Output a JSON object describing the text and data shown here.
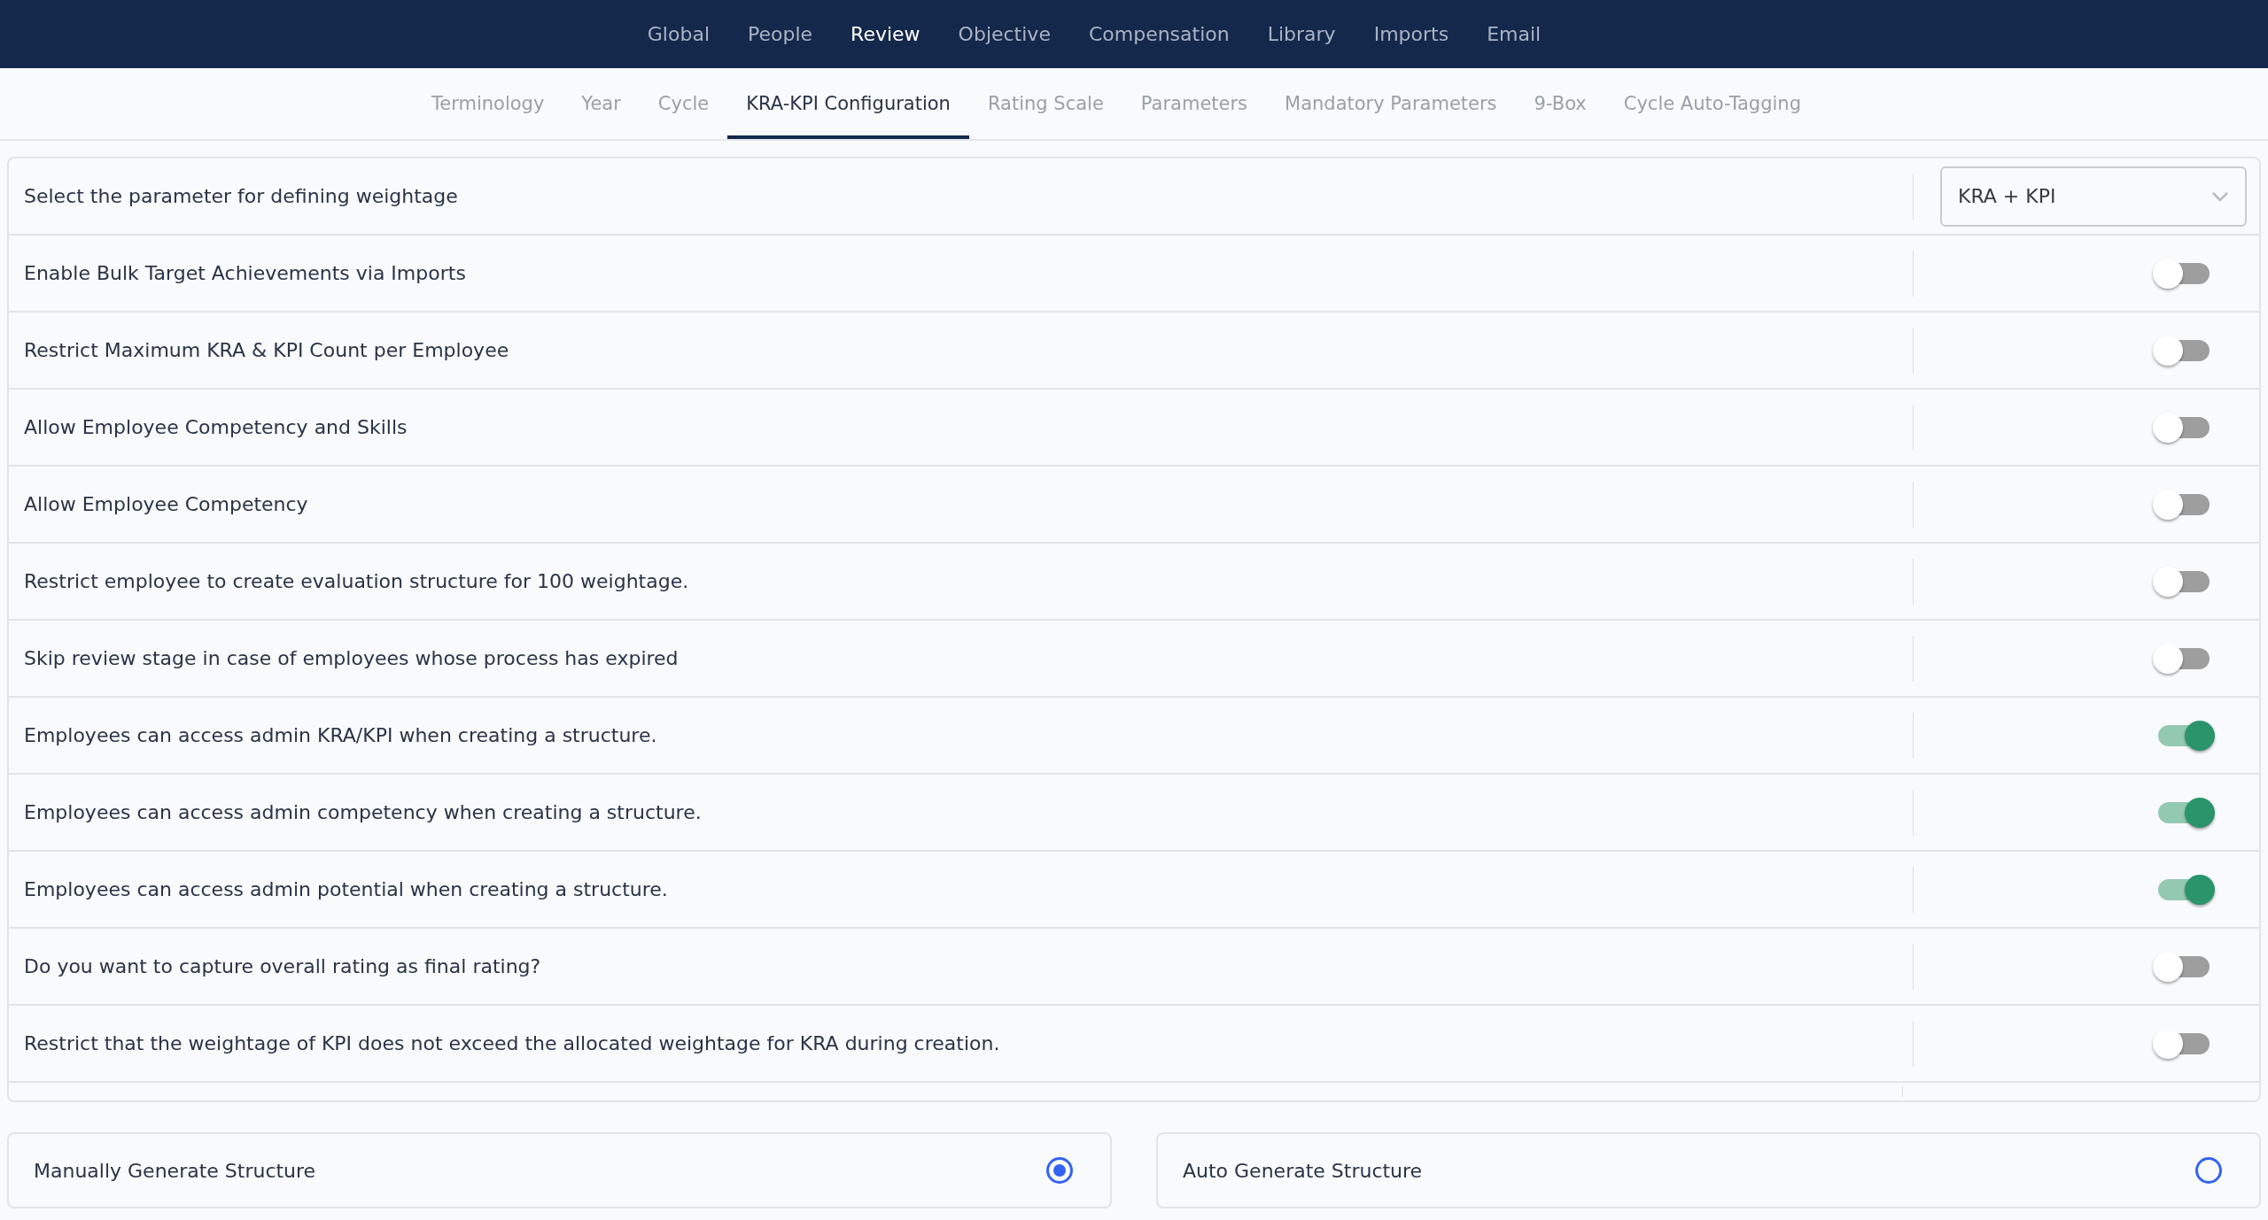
{
  "top_nav": [
    {
      "label": "Global",
      "selected": false
    },
    {
      "label": "People",
      "selected": false
    },
    {
      "label": "Review",
      "selected": true
    },
    {
      "label": "Objective",
      "selected": false
    },
    {
      "label": "Compensation",
      "selected": false
    },
    {
      "label": "Library",
      "selected": false
    },
    {
      "label": "Imports",
      "selected": false
    },
    {
      "label": "Email",
      "selected": false
    }
  ],
  "tabs": [
    {
      "label": "Terminology",
      "selected": false
    },
    {
      "label": "Year",
      "selected": false
    },
    {
      "label": "Cycle",
      "selected": false
    },
    {
      "label": "KRA-KPI Configuration",
      "selected": true
    },
    {
      "label": "Rating Scale",
      "selected": false
    },
    {
      "label": "Parameters",
      "selected": false
    },
    {
      "label": "Mandatory Parameters",
      "selected": false
    },
    {
      "label": "9-Box",
      "selected": false
    },
    {
      "label": "Cycle Auto-Tagging",
      "selected": false
    }
  ],
  "settings": [
    {
      "kind": "dropdown",
      "label": "Select the parameter for defining weightage",
      "value": "KRA + KPI"
    },
    {
      "kind": "toggle",
      "label": "Enable Bulk Target Achievements via Imports",
      "on": false
    },
    {
      "kind": "toggle",
      "label": "Restrict Maximum KRA & KPI Count per Employee",
      "on": false
    },
    {
      "kind": "toggle",
      "label": "Allow Employee Competency and Skills",
      "on": false
    },
    {
      "kind": "toggle",
      "label": "Allow Employee Competency",
      "on": false
    },
    {
      "kind": "toggle",
      "label": "Restrict employee to create evaluation structure for 100 weightage.",
      "on": false
    },
    {
      "kind": "toggle",
      "label": "Skip review stage in case of employees whose process has expired",
      "on": false
    },
    {
      "kind": "toggle",
      "label": "Employees can access admin KRA/KPI when creating a structure.",
      "on": true
    },
    {
      "kind": "toggle",
      "label": "Employees can access admin competency when creating a structure.",
      "on": true
    },
    {
      "kind": "toggle",
      "label": "Employees can access admin potential when creating a structure.",
      "on": true
    },
    {
      "kind": "toggle",
      "label": "Do you want to capture overall rating as final rating?",
      "on": false
    },
    {
      "kind": "toggle",
      "label": "Restrict that the weightage of KPI does not exceed the allocated weightage for KRA during creation.",
      "on": false
    }
  ],
  "structure_options": [
    {
      "label": "Manually Generate Structure",
      "selected": true
    },
    {
      "label": "Auto Generate Structure",
      "selected": false
    }
  ]
}
